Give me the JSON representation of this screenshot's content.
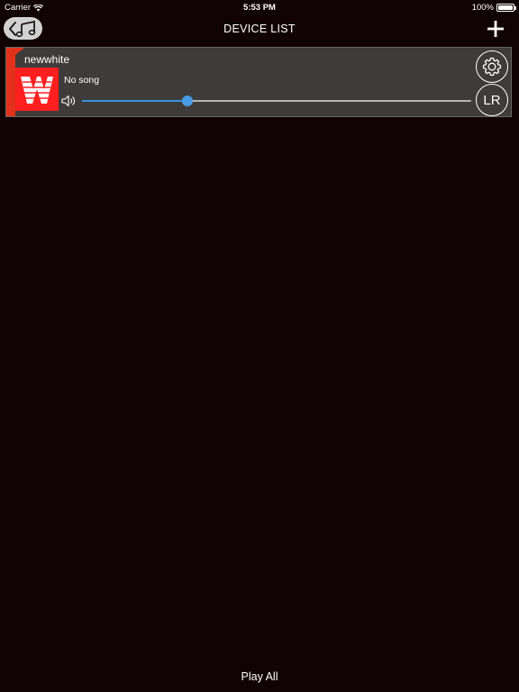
{
  "status_bar": {
    "carrier": "Carrier",
    "time": "5:53 PM",
    "battery": "100%"
  },
  "nav": {
    "title": "DEVICE LIST",
    "back_icon": "back-music-icon",
    "add_icon": "plus-icon"
  },
  "devices": [
    {
      "name": "newwhite",
      "song": "No song",
      "volume": 0.27,
      "logo_color": "#ff1f1f",
      "accent_color": "#e2321c",
      "settings_icon": "gear-icon",
      "channel_label": "LR"
    }
  ],
  "footer": {
    "play_all_label": "Play All"
  },
  "colors": {
    "background": "#110203",
    "card": "#3f3b3a",
    "slider_fill": "#3c8fe2"
  }
}
